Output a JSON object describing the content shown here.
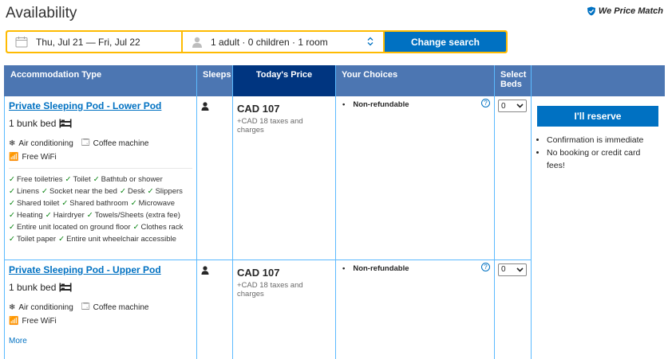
{
  "page": {
    "title": "Availability",
    "price_match": "We Price Match"
  },
  "search": {
    "dates": "Thu, Jul 21 — Fri, Jul 22",
    "guests": "1 adult · 0 children · 1 room",
    "change_button": "Change search"
  },
  "table": {
    "headers": {
      "type": "Accommodation Type",
      "sleeps": "Sleeps",
      "price": "Today's Price",
      "choices": "Your Choices",
      "select": "Select Beds"
    }
  },
  "rooms": [
    {
      "name": "Private Sleeping Pod - Lower Pod",
      "bed": "1 bunk bed",
      "facilities": [
        "Air conditioning",
        "Coffee machine",
        "Free WiFi"
      ],
      "amenities": [
        "Free toiletries",
        "Toilet",
        "Bathtub or shower",
        "Linens",
        "Socket near the bed",
        "Desk",
        "Slippers",
        "Shared toilet",
        "Shared bathroom",
        "Microwave",
        "Heating",
        "Hairdryer",
        "Towels/Sheets (extra fee)",
        "Entire unit located on ground floor",
        "Clothes rack",
        "Toilet paper",
        "Entire unit wheelchair accessible"
      ],
      "price": "CAD 107",
      "taxes": "+CAD 18 taxes and charges",
      "choice": "Non-refundable",
      "select_value": "0"
    },
    {
      "name": "Private Sleeping Pod - Upper Pod",
      "bed": "1 bunk bed",
      "facilities": [
        "Air conditioning",
        "Coffee machine",
        "Free WiFi"
      ],
      "more": "More",
      "price": "CAD 107",
      "taxes": "+CAD 18 taxes and charges",
      "choice": "Non-refundable",
      "select_value": "0"
    }
  ],
  "reserve": {
    "button": "I'll reserve",
    "notes": [
      "Confirmation is immediate",
      "No booking or credit card fees!"
    ]
  },
  "colors": {
    "header_bg": "#4c76b2",
    "price_header_bg": "#003580",
    "button_blue": "#0071c2",
    "search_border": "#febb02",
    "check_green": "#008009"
  }
}
